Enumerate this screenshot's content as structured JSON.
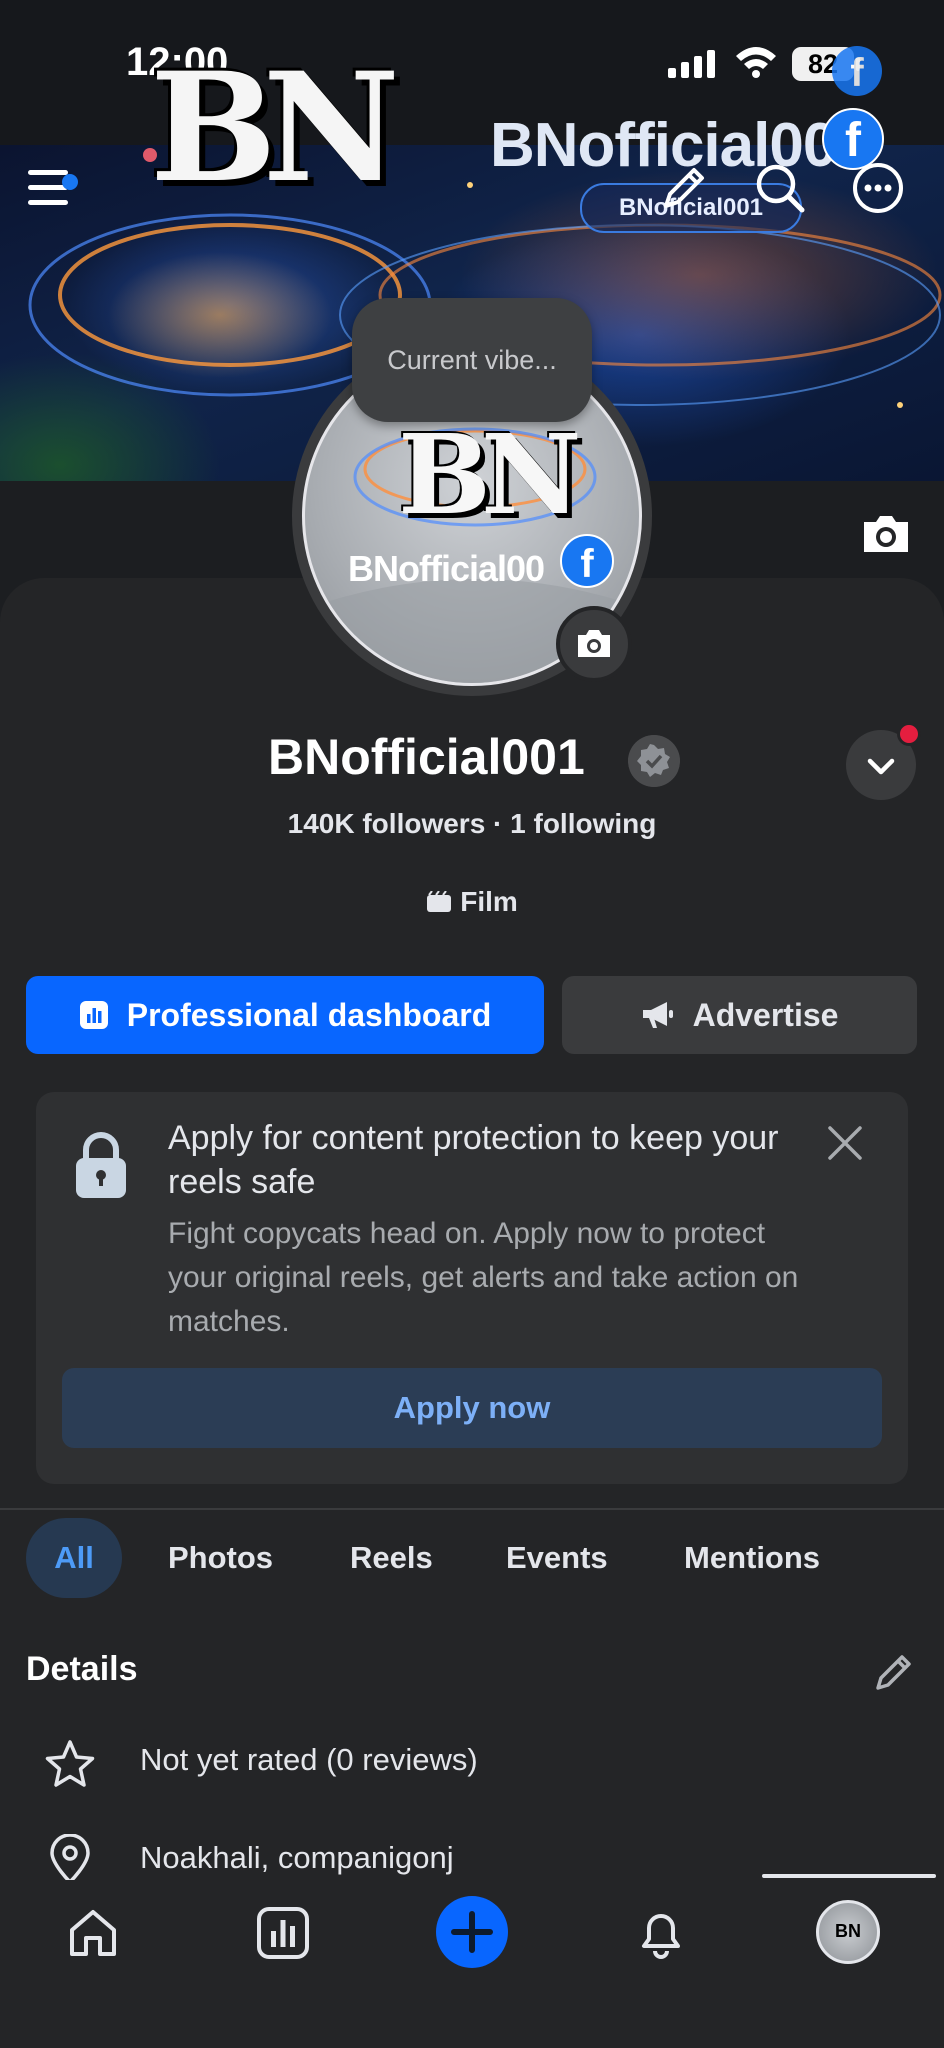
{
  "status_bar": {
    "time": "12:00",
    "battery": "82"
  },
  "cover": {
    "logo_text": "BN",
    "title_text": "BNofficial00",
    "fb_letter": "f",
    "handle_text": "BNoficial001"
  },
  "avatar": {
    "logo_text": "BN",
    "name_text": "BNofficial00",
    "fb_letter": "f",
    "vibe_placeholder": "Current vibe..."
  },
  "profile": {
    "name": "BNofficial001",
    "followers_text": "140K followers · 1 following",
    "category": "Film"
  },
  "actions": {
    "dashboard_label": "Professional dashboard",
    "advertise_label": "Advertise"
  },
  "protection_card": {
    "title": "Apply for content protection to keep your reels safe",
    "body": "Fight copycats head on. Apply now to protect your original reels, get alerts and take action on matches.",
    "button_label": "Apply now"
  },
  "tabs": [
    {
      "label": "All",
      "selected": true
    },
    {
      "label": "Photos"
    },
    {
      "label": "Reels"
    },
    {
      "label": "Events"
    },
    {
      "label": "Mentions"
    }
  ],
  "details": {
    "title": "Details",
    "rating": "Not yet rated (0 reviews)",
    "location": "Noakhali, companigonj"
  },
  "bottom_nav": {
    "profile_initials": "BN",
    "icons": [
      "home-icon",
      "dashboard-icon",
      "create-icon",
      "bell-icon",
      "profile-avatar"
    ]
  },
  "colors": {
    "accent": "#0866ff",
    "background": "#242527",
    "notification_dot": "#e41e3f"
  }
}
